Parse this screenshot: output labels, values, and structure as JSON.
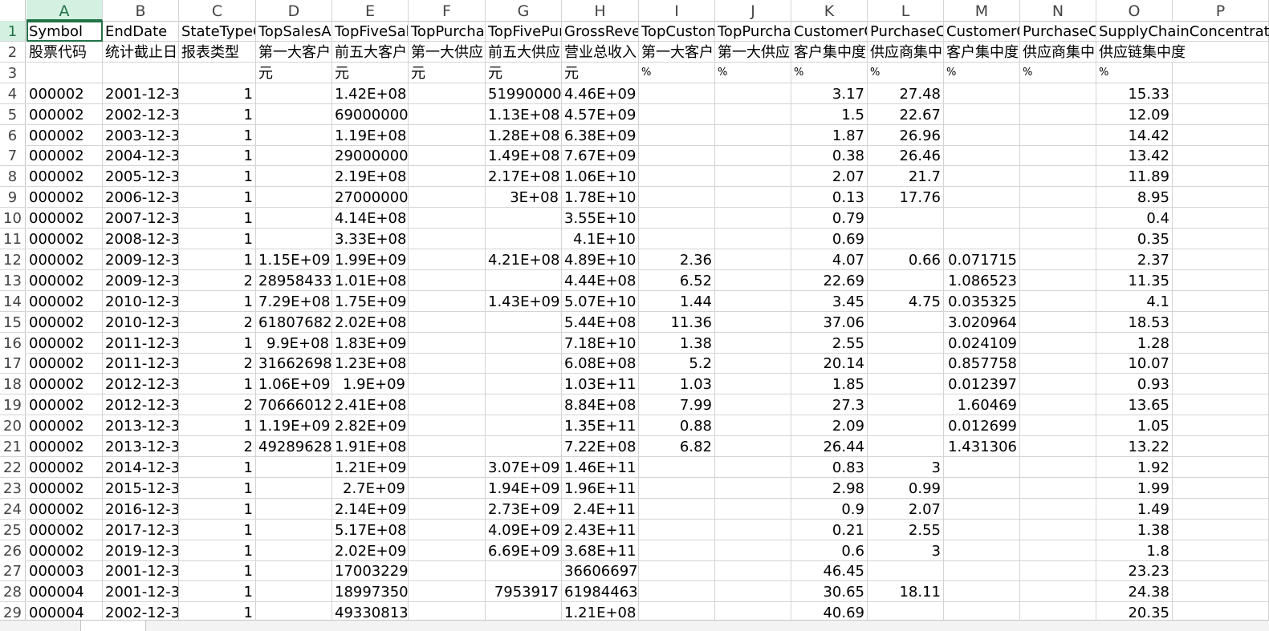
{
  "sheet": {
    "columns": [
      "A",
      "B",
      "C",
      "D",
      "E",
      "F",
      "G",
      "H",
      "I",
      "J",
      "K",
      "L",
      "M",
      "N",
      "O",
      "P"
    ],
    "active_column": "A",
    "active_row": 1,
    "rows": [
      [
        "Symbol",
        "EndDate",
        "StateTypeC",
        "TopSalesAr",
        "TopFiveSal",
        "TopPurcha",
        "TopFivePur",
        "GrossRever",
        "TopCustom",
        "TopPurcha",
        "CustomerC",
        "PurchaseC",
        "CustomerC",
        "PurchaseC",
        "SupplyChainConcentrati",
        ""
      ],
      [
        "股票代码",
        "统计截止日",
        "报表类型",
        "第一大客户",
        "前五大客户",
        "第一大供应",
        "前五大供应",
        "营业总收入",
        "第一大客户",
        "第一大供应",
        "客户集中度",
        "供应商集中",
        "客户集中度",
        "供应商集中",
        "供应链集中度",
        ""
      ],
      [
        "",
        "",
        "",
        "元",
        "元",
        "元",
        "元",
        "元",
        "%",
        "%",
        "%",
        "%",
        "%",
        "%",
        "%",
        ""
      ],
      [
        "000002",
        "2001-12-3",
        "1",
        "",
        "1.42E+08",
        "",
        "51990000",
        "4.46E+09",
        "",
        "",
        "3.17",
        "27.48",
        "",
        "",
        "15.33",
        ""
      ],
      [
        "000002",
        "2002-12-3",
        "1",
        "",
        "69000000",
        "",
        "1.13E+08",
        "4.57E+09",
        "",
        "",
        "1.5",
        "22.67",
        "",
        "",
        "12.09",
        ""
      ],
      [
        "000002",
        "2003-12-3",
        "1",
        "",
        "1.19E+08",
        "",
        "1.28E+08",
        "6.38E+09",
        "",
        "",
        "1.87",
        "26.96",
        "",
        "",
        "14.42",
        ""
      ],
      [
        "000002",
        "2004-12-3",
        "1",
        "",
        "29000000",
        "",
        "1.49E+08",
        "7.67E+09",
        "",
        "",
        "0.38",
        "26.46",
        "",
        "",
        "13.42",
        ""
      ],
      [
        "000002",
        "2005-12-3",
        "1",
        "",
        "2.19E+08",
        "",
        "2.17E+08",
        "1.06E+10",
        "",
        "",
        "2.07",
        "21.7",
        "",
        "",
        "11.89",
        ""
      ],
      [
        "000002",
        "2006-12-3",
        "1",
        "",
        "27000000",
        "",
        "3E+08",
        "1.78E+10",
        "",
        "",
        "0.13",
        "17.76",
        "",
        "",
        "8.95",
        ""
      ],
      [
        "000002",
        "2007-12-3",
        "1",
        "",
        "4.14E+08",
        "",
        "",
        "3.55E+10",
        "",
        "",
        "0.79",
        "",
        "",
        "",
        "0.4",
        ""
      ],
      [
        "000002",
        "2008-12-3",
        "1",
        "",
        "3.33E+08",
        "",
        "",
        "4.1E+10",
        "",
        "",
        "0.69",
        "",
        "",
        "",
        "0.35",
        ""
      ],
      [
        "000002",
        "2009-12-3",
        "1",
        "1.15E+09",
        "1.99E+09",
        "",
        "4.21E+08",
        "4.89E+10",
        "2.36",
        "",
        "4.07",
        "0.66",
        "0.071715",
        "",
        "2.37",
        ""
      ],
      [
        "000002",
        "2009-12-3",
        "2",
        "28958433",
        "1.01E+08",
        "",
        "",
        "4.44E+08",
        "6.52",
        "",
        "22.69",
        "",
        "1.086523",
        "",
        "11.35",
        ""
      ],
      [
        "000002",
        "2010-12-3",
        "1",
        "7.29E+08",
        "1.75E+09",
        "",
        "1.43E+09",
        "5.07E+10",
        "1.44",
        "",
        "3.45",
        "4.75",
        "0.035325",
        "",
        "4.1",
        ""
      ],
      [
        "000002",
        "2010-12-3",
        "2",
        "61807682",
        "2.02E+08",
        "",
        "",
        "5.44E+08",
        "11.36",
        "",
        "37.06",
        "",
        "3.020964",
        "",
        "18.53",
        ""
      ],
      [
        "000002",
        "2011-12-3",
        "1",
        "9.9E+08",
        "1.83E+09",
        "",
        "",
        "7.18E+10",
        "1.38",
        "",
        "2.55",
        "",
        "0.024109",
        "",
        "1.28",
        ""
      ],
      [
        "000002",
        "2011-12-3",
        "2",
        "31662698",
        "1.23E+08",
        "",
        "",
        "6.08E+08",
        "5.2",
        "",
        "20.14",
        "",
        "0.857758",
        "",
        "10.07",
        ""
      ],
      [
        "000002",
        "2012-12-3",
        "1",
        "1.06E+09",
        "1.9E+09",
        "",
        "",
        "1.03E+11",
        "1.03",
        "",
        "1.85",
        "",
        "0.012397",
        "",
        "0.93",
        ""
      ],
      [
        "000002",
        "2012-12-3",
        "2",
        "70666012",
        "2.41E+08",
        "",
        "",
        "8.84E+08",
        "7.99",
        "",
        "27.3",
        "",
        "1.60469",
        "",
        "13.65",
        ""
      ],
      [
        "000002",
        "2013-12-3",
        "1",
        "1.19E+09",
        "2.82E+09",
        "",
        "",
        "1.35E+11",
        "0.88",
        "",
        "2.09",
        "",
        "0.012699",
        "",
        "1.05",
        ""
      ],
      [
        "000002",
        "2013-12-3",
        "2",
        "49289628",
        "1.91E+08",
        "",
        "",
        "7.22E+08",
        "6.82",
        "",
        "26.44",
        "",
        "1.431306",
        "",
        "13.22",
        ""
      ],
      [
        "000002",
        "2014-12-3",
        "1",
        "",
        "1.21E+09",
        "",
        "3.07E+09",
        "1.46E+11",
        "",
        "",
        "0.83",
        "3",
        "",
        "",
        "1.92",
        ""
      ],
      [
        "000002",
        "2015-12-3",
        "1",
        "",
        "2.7E+09",
        "",
        "1.94E+09",
        "1.96E+11",
        "",
        "",
        "2.98",
        "0.99",
        "",
        "",
        "1.99",
        ""
      ],
      [
        "000002",
        "2016-12-3",
        "1",
        "",
        "2.14E+09",
        "",
        "2.73E+09",
        "2.4E+11",
        "",
        "",
        "0.9",
        "2.07",
        "",
        "",
        "1.49",
        ""
      ],
      [
        "000002",
        "2017-12-3",
        "1",
        "",
        "5.17E+08",
        "",
        "4.09E+09",
        "2.43E+11",
        "",
        "",
        "0.21",
        "2.55",
        "",
        "",
        "1.38",
        ""
      ],
      [
        "000002",
        "2019-12-3",
        "1",
        "",
        "2.02E+09",
        "",
        "6.69E+09",
        "3.68E+11",
        "",
        "",
        "0.6",
        "3",
        "",
        "",
        "1.8",
        ""
      ],
      [
        "000003",
        "2001-12-3",
        "1",
        "",
        "17003229",
        "",
        "",
        "36606697",
        "",
        "",
        "46.45",
        "",
        "",
        "",
        "23.23",
        ""
      ],
      [
        "000004",
        "2001-12-3",
        "1",
        "",
        "18997350",
        "",
        "7953917",
        "61984463",
        "",
        "",
        "30.65",
        "18.11",
        "",
        "",
        "24.38",
        ""
      ],
      [
        "000004",
        "2002-12-3",
        "1",
        "",
        "49330813",
        "",
        "",
        "1.21E+08",
        "",
        "",
        "40.69",
        "",
        "",
        "",
        "20.35",
        ""
      ]
    ]
  }
}
